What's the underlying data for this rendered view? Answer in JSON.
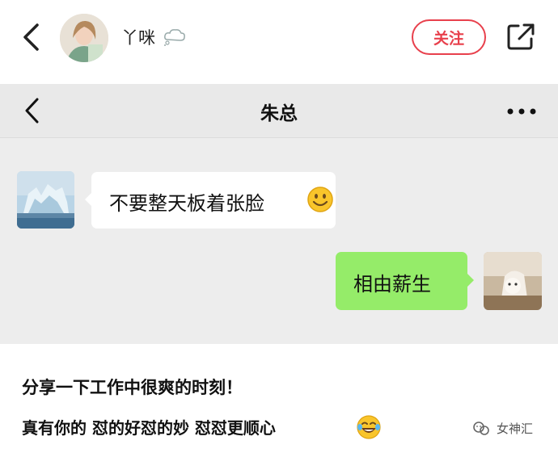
{
  "header": {
    "username": "丫咪",
    "follow_label": "关注"
  },
  "chat": {
    "title": "朱总",
    "messages": [
      {
        "side": "left",
        "text": "不要整天板着张脸"
      },
      {
        "side": "right",
        "text": "相由薪生"
      }
    ]
  },
  "post": {
    "title": "分享一下工作中很爽的时刻！",
    "body": "真有你的  怼的好怼的妙 怼怼更顺心",
    "watermark": "女神汇"
  },
  "colors": {
    "follow": "#e8404c",
    "chat_bg": "#ededed",
    "my_bubble": "#95ec69"
  },
  "icons": [
    "back-icon",
    "thought-bubble-icon",
    "share-icon",
    "more-icon",
    "smile-emoji-icon",
    "laugh-emoji-icon",
    "watermark-logo-icon"
  ]
}
